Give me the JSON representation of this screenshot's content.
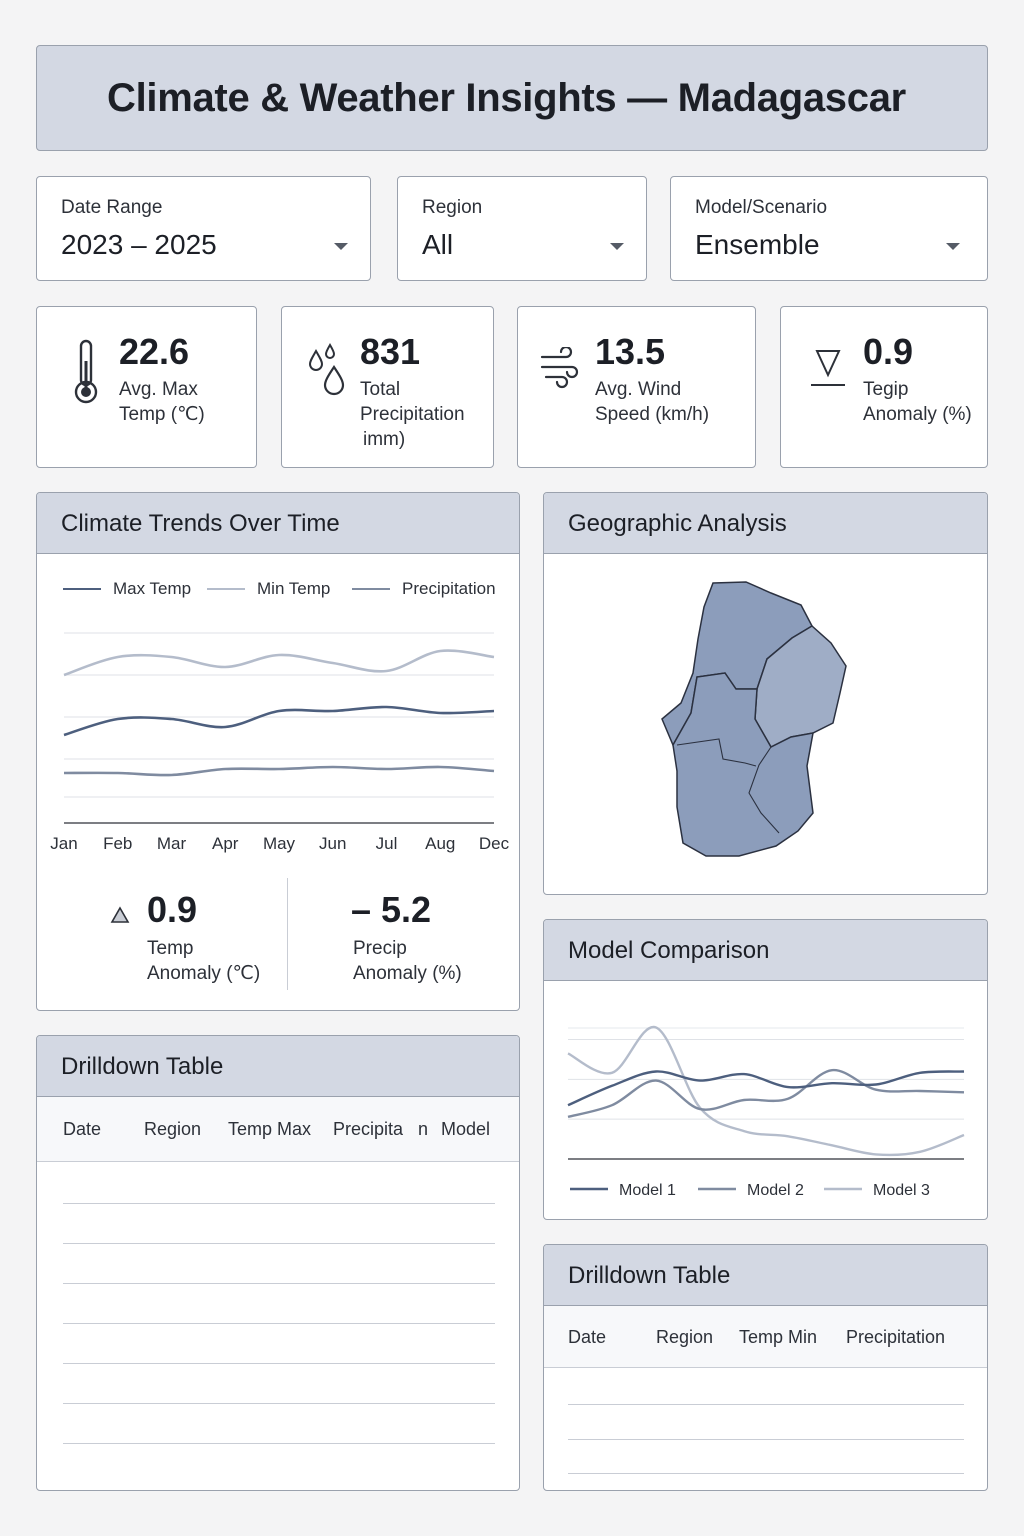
{
  "header": {
    "title": "Climate & Weather Insights — Madagascar"
  },
  "filters": [
    {
      "label": "Date Range",
      "value": "2023 – 2025"
    },
    {
      "label": "Region",
      "value": "All"
    },
    {
      "label": "Model/Scenario",
      "value": "Ensemble"
    }
  ],
  "kpis": [
    {
      "value": "22.6",
      "label_line1": "Avg. Max",
      "label_line2": "Temp (℃)",
      "icon": "thermometer-icon"
    },
    {
      "value": "831",
      "label_line1": "Total",
      "label_line2": "Precipitation",
      "label_line3": "imm)",
      "icon": "droplets-icon"
    },
    {
      "value": "13.5",
      "label_line1": "Avg. Wind",
      "label_line2": "Speed (km/h)",
      "icon": "wind-icon"
    },
    {
      "value": "0.9",
      "label_line1": "Tegip",
      "label_line2": "Anomaly (%)",
      "icon": "triangle-down-icon"
    }
  ],
  "trends": {
    "title": "Climate Trends Over Time",
    "legend": [
      "Max Temp",
      "Min Temp",
      "Precipitation"
    ],
    "anomalies": [
      {
        "value": "0.9",
        "label_line1": "Temp",
        "label_line2": "Anomaly (℃)"
      },
      {
        "value": "– 5.2",
        "label_line1": "Precip",
        "label_line2": "Anomaly (%)"
      }
    ]
  },
  "geo": {
    "title": "Geographic Analysis"
  },
  "model_comparison": {
    "title": "Model Comparison"
  },
  "drilldown_left": {
    "title": "Drilldown Table",
    "columns": [
      "Date",
      "Region",
      "Temp Max",
      "Precipita   n",
      "Model"
    ]
  },
  "drilldown_right": {
    "title": "Drilldown Table",
    "columns": [
      "Date",
      "Region",
      "Temp Min",
      "Precipitation"
    ]
  },
  "colors": {
    "panel_header": "#d3d8e3",
    "series_dark": "#4d5f7e",
    "series_light": "#b4bccb",
    "series_mid": "#7f8ba0",
    "map_fill": "#8c9dbb",
    "map_fill_light": "#9fadc6"
  },
  "chart_data": [
    {
      "type": "line",
      "title": "Climate Trends Over Time",
      "x": [
        "Jan",
        "Feb",
        "Mar",
        "Apr",
        "May",
        "Jun",
        "Jul",
        "Aug",
        "Dec"
      ],
      "series": [
        {
          "name": "Max Temp",
          "values": [
            4.4,
            5.2,
            5.2,
            4.8,
            5.6,
            5.6,
            5.8,
            5.5,
            5.6
          ]
        },
        {
          "name": "Min Temp",
          "values": [
            7.4,
            8.3,
            8.3,
            7.8,
            8.4,
            8.0,
            7.6,
            8.6,
            8.3
          ]
        },
        {
          "name": "Precipitation",
          "values": [
            2.5,
            2.5,
            2.4,
            2.7,
            2.7,
            2.8,
            2.7,
            2.8,
            2.6
          ]
        }
      ],
      "ylim": [
        0,
        10
      ],
      "grid": true,
      "legend": "top"
    },
    {
      "type": "line",
      "title": "Model Comparison",
      "x": [
        1,
        2,
        3,
        4,
        5,
        6,
        7,
        8,
        9,
        10
      ],
      "series": [
        {
          "name": "Model 1",
          "values": [
            4.0,
            5.5,
            6.6,
            5.9,
            6.4,
            5.4,
            5.7,
            5.6,
            6.5,
            6.6
          ]
        },
        {
          "name": "Model 2",
          "values": [
            3.1,
            4.0,
            5.9,
            3.7,
            4.4,
            4.5,
            6.7,
            5.2,
            5.1,
            5.0
          ]
        },
        {
          "name": "Model 3",
          "values": [
            8.0,
            6.5,
            10.0,
            3.8,
            2.0,
            1.6,
            0.9,
            0.2,
            0.4,
            1.7
          ]
        }
      ],
      "ylim": [
        0,
        10
      ],
      "grid": true,
      "legend": "bottom"
    }
  ]
}
